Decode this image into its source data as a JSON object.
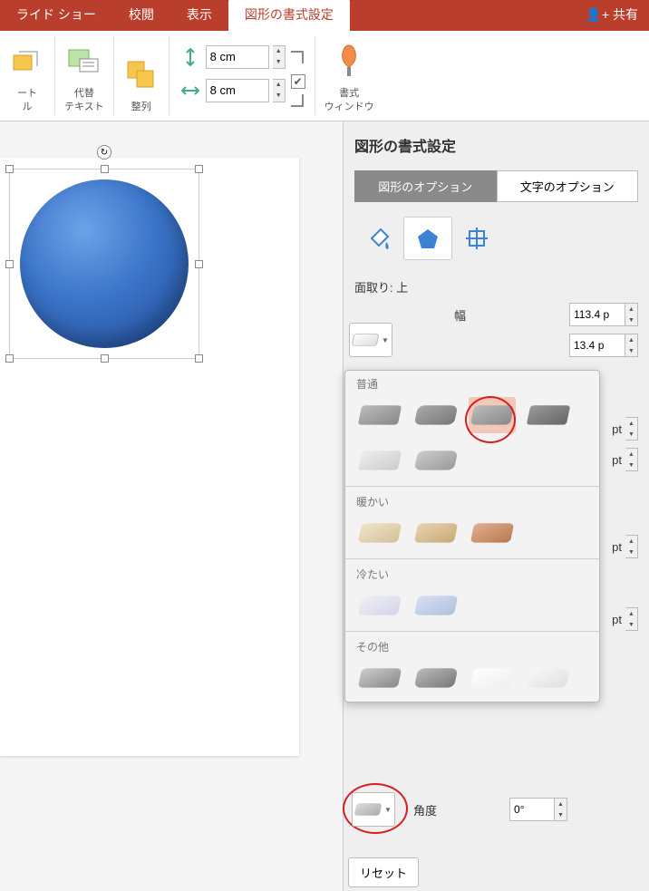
{
  "tabs": {
    "slideshow": "ライド ショー",
    "review": "校閲",
    "view": "表示",
    "shape_format": "図形の書式設定"
  },
  "share": "共有",
  "ribbon": {
    "art_label": "ート\nル",
    "alt_text": "代替\nテキスト",
    "arrange": "整列",
    "height": "8 cm",
    "width": "8 cm",
    "format_window": "書式\nウィンドウ"
  },
  "pane": {
    "title": "図形の書式設定",
    "tab_shape": "図形のオプション",
    "tab_text": "文字のオプション",
    "section_bevel_top": "面取り: 上",
    "label_width": "幅",
    "val_width": "113.4 p",
    "val_w2": "13.4 p",
    "unit_pt": "pt",
    "label_angle": "角度",
    "val_angle": "0°",
    "reset": "リセット"
  },
  "popup": {
    "sec_normal": "普通",
    "sec_warm": "暖かい",
    "sec_cool": "冷たい",
    "sec_other": "その他"
  }
}
